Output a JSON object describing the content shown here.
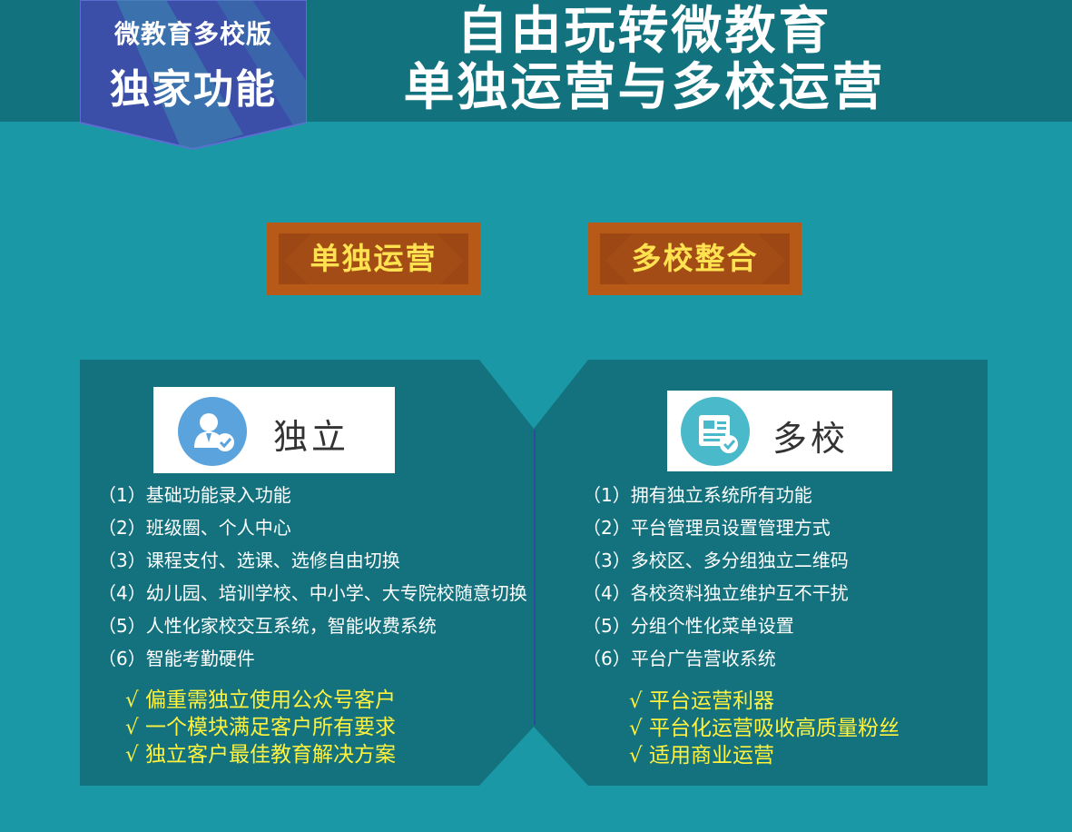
{
  "header": {
    "badge_line1": "微教育多校版",
    "badge_line2": "独家功能",
    "title_line1": "自由玩转微教育",
    "title_line2": "单独运营与多校运营"
  },
  "tags": {
    "left": "单独运营",
    "right": "多校整合"
  },
  "left_panel": {
    "icon": "user-check-icon",
    "title": "独立",
    "features": [
      "（1）基础功能录入功能",
      "（2）班级圈、个人中心",
      "（3）课程支付、选课、选修自由切换",
      "（4）幼儿园、培训学校、中小学、大专院校随意切换",
      "（5）人性化家校交互系统，智能收费系统",
      "（6）智能考勤硬件"
    ],
    "highlights": [
      "√ 偏重需独立使用公众号客户",
      "√ 一个模块满足客户所有要求",
      "√ 独立客户最佳教育解决方案"
    ]
  },
  "right_panel": {
    "icon": "document-check-icon",
    "title": "多校",
    "features": [
      "（1）拥有独立系统所有功能",
      "（2）平台管理员设置管理方式",
      "（3）多校区、多分组独立二维码",
      "（4）各校资料独立维护互不干扰",
      "（5）分组个性化菜单设置",
      "（6）平台广告营收系统"
    ],
    "highlights": [
      "√ 平台运营利器",
      "√ 平台化运营吸收高质量粉丝",
      "√ 适用商业运营"
    ]
  },
  "colors": {
    "background": "#1b98a6",
    "header_band": "#12737f",
    "panel": "#13727e",
    "badge_blue": "#3b4fa8",
    "tag_orange": "#b85a17",
    "tag_text": "#ffe24f",
    "highlight_text": "#fff23f"
  }
}
